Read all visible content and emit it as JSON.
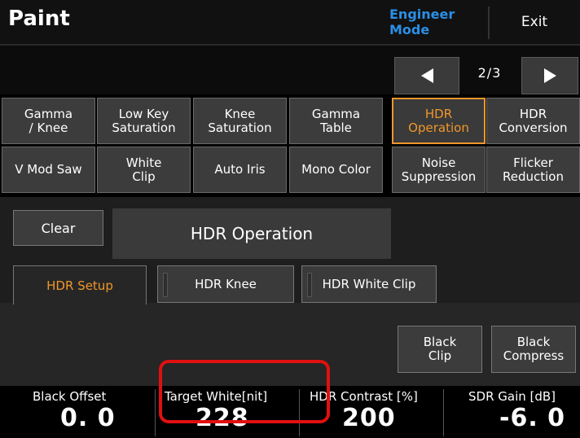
{
  "header": {
    "title": "Paint",
    "mode": "Engineer Mode",
    "exit_label": "Exit",
    "mode_color": "#2b8fe6"
  },
  "pager": {
    "indicator": "2/3",
    "prev_icon": "triangle-left-icon",
    "next_icon": "triangle-right-icon"
  },
  "grid": {
    "row1": [
      "Gamma\n/ Knee",
      "Low Key\nSaturation",
      "Knee\nSaturation",
      "Gamma\nTable",
      "HDR\nOperation",
      "HDR\nConversion"
    ],
    "row2": [
      "V Mod Saw",
      "White\nClip",
      "Auto Iris",
      "Mono Color",
      "Noise\nSuppression",
      "Flicker\nReduction"
    ],
    "active_index": 4,
    "active_color": "#f0972a"
  },
  "section": {
    "clear_label": "Clear",
    "title": "HDR Operation"
  },
  "tabs": [
    {
      "label": "HDR Setup",
      "active": true
    },
    {
      "label": "HDR Knee",
      "active": false
    },
    {
      "label": "HDR White Clip",
      "active": false
    }
  ],
  "actions": {
    "black_clip": "Black\nClip",
    "black_compress": "Black\nCompress"
  },
  "params": [
    {
      "label": "Black Offset",
      "value": "0. 0"
    },
    {
      "label": "Target White[nit]",
      "value": "228"
    },
    {
      "label": "HDR Contrast [%]",
      "value": "200"
    },
    {
      "label": "SDR Gain [dB]",
      "value": "-6. 0"
    }
  ],
  "highlight_color": "#e01010"
}
